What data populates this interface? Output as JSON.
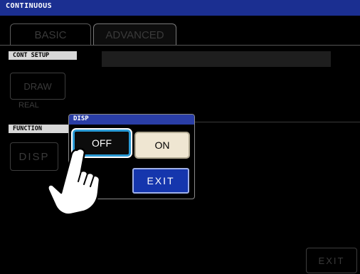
{
  "window": {
    "title": "CONTINUOUS"
  },
  "tabs": [
    {
      "label": "BASIC"
    },
    {
      "label": "ADVANCED"
    }
  ],
  "cont_setup": {
    "label": "CONT SETUP",
    "draw_button": "DRAW",
    "draw_mode": "REAL"
  },
  "function": {
    "label": "FUNCTION",
    "disp_button": "DISP"
  },
  "dialog": {
    "title": "DISP",
    "off_label": "OFF",
    "on_label": "ON",
    "exit_label": "EXIT",
    "selected": "OFF"
  },
  "footer": {
    "exit_label": "EXIT"
  },
  "colors": {
    "title_bar": "#1b2f91",
    "selection_highlight": "#2a9bd6",
    "exit_button": "#1536ad",
    "on_button": "#efe6d2"
  },
  "icons": {
    "hand_pointer": "hand-pointer-icon"
  }
}
